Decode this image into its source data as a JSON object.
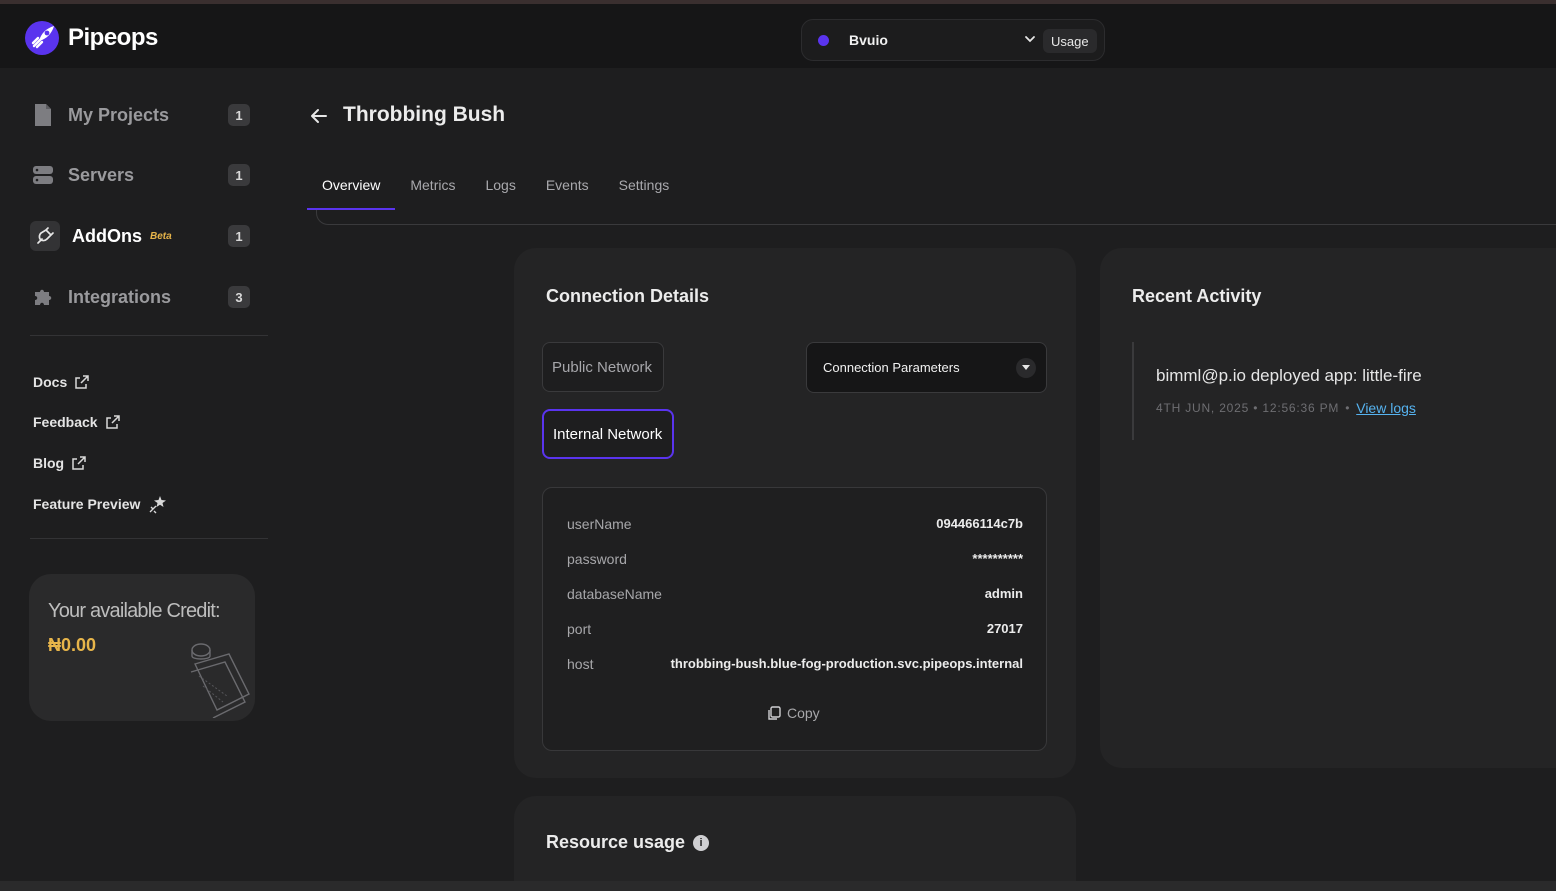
{
  "app": {
    "name": "Pipeops"
  },
  "header": {
    "project_name": "Bvuio",
    "usage_label": "Usage"
  },
  "sidebar": {
    "items": [
      {
        "label": "My Projects",
        "count": "1"
      },
      {
        "label": "Servers",
        "count": "1"
      },
      {
        "label": "AddOns",
        "badge": "Beta",
        "count": "1"
      },
      {
        "label": "Integrations",
        "count": "3"
      }
    ],
    "links": [
      {
        "label": "Docs"
      },
      {
        "label": "Feedback"
      },
      {
        "label": "Blog"
      },
      {
        "label": "Feature Preview"
      }
    ],
    "credit": {
      "title": "Your available Credit:",
      "amount": "₦0.00"
    }
  },
  "page": {
    "title": "Throbbing Bush",
    "tabs": [
      "Overview",
      "Metrics",
      "Logs",
      "Events",
      "Settings"
    ],
    "active_tab": "Overview"
  },
  "connection": {
    "title": "Connection Details",
    "public_network_label": "Public Network",
    "internal_network_label": "Internal Network",
    "selected_network": "Internal Network",
    "parameters_select": "Connection Parameters",
    "params": [
      {
        "key": "userName",
        "value": "094466114c7b"
      },
      {
        "key": "password",
        "value": "**********"
      },
      {
        "key": "databaseName",
        "value": "admin"
      },
      {
        "key": "port",
        "value": "27017"
      },
      {
        "key": "host",
        "value": "throbbing-bush.blue-fog-production.svc.pipeops.internal"
      }
    ],
    "copy_label": "Copy"
  },
  "activity": {
    "title": "Recent Activity",
    "items": [
      {
        "text": "bimml@p.io deployed app: little-fire",
        "timestamp": "4TH JUN, 2025 • 12:56:36 PM",
        "link": "View logs"
      }
    ]
  },
  "resource": {
    "title": "Resource usage"
  },
  "colors": {
    "accent": "#5a34ee",
    "credit": "#e7b54a",
    "link": "#56b3f0"
  }
}
